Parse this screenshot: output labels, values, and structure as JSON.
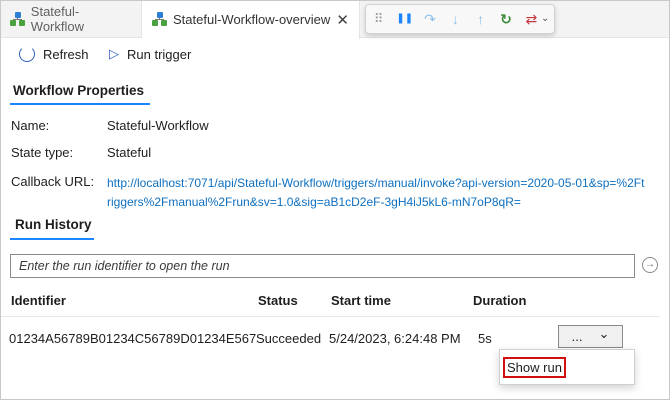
{
  "tabs": [
    {
      "label": "Stateful-Workflow",
      "icon": "workflow-icon"
    },
    {
      "label": "Stateful-Workflow-overview",
      "icon": "workflow-icon",
      "close": "✕"
    }
  ],
  "debug_toolbar": {
    "grip": "⠿",
    "pause": "❚❚",
    "step_over": "↷",
    "step_into": "↓",
    "step_out": "↑",
    "restart": "↻",
    "disconnect": "⇄",
    "caret": "⌄"
  },
  "commands": {
    "refresh_label": "Refresh",
    "run_trigger_label": "Run trigger"
  },
  "workflow_properties": {
    "heading": "Workflow Properties",
    "name_label": "Name:",
    "name_value": "Stateful-Workflow",
    "state_label": "State type:",
    "state_value": "Stateful",
    "callback_label": "Callback URL:",
    "callback_url": "http://localhost:7071/api/Stateful-Workflow/triggers/manual/invoke?api-version=2020-05-01&sp=%2Ftriggers%2Fmanual%2Frun&sv=1.0&sig=aB1cD2eF-3gH4iJ5kL6-mN7oP8qR="
  },
  "run_history": {
    "heading": "Run History",
    "search_placeholder": "Enter the run identifier to open the run",
    "go_icon": "→",
    "columns": [
      "Identifier",
      "Status",
      "Start time",
      "Duration"
    ],
    "rows": [
      {
        "identifier": "01234A56789B01234C56789D01234E567",
        "status": "Succeeded",
        "start_time": "5/24/2023, 6:24:48 PM",
        "duration": "5s"
      }
    ],
    "more_button": {
      "dots": "...",
      "chevron": "⌄"
    },
    "context_menu": {
      "item": "Show run"
    }
  },
  "colors": {
    "accent": "#1a85ff",
    "link": "#0e70c0",
    "highlight_box": "#d20f0f"
  }
}
